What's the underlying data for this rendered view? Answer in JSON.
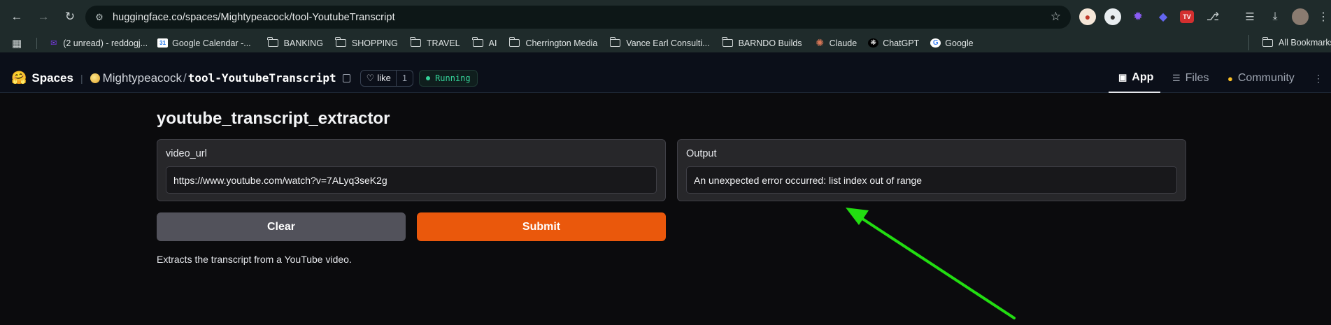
{
  "browser": {
    "url": "huggingface.co/spaces/Mightypeacock/tool-YoutubeTranscript",
    "bookmarks": [
      {
        "label": "(2 unread) - reddogj...",
        "icon": "yahoo-mail-icon",
        "type": "site"
      },
      {
        "label": "Google Calendar -...",
        "icon": "calendar-icon",
        "type": "site"
      },
      {
        "label": "BANKING",
        "icon": "folder-icon",
        "type": "folder"
      },
      {
        "label": "SHOPPING",
        "icon": "folder-icon",
        "type": "folder"
      },
      {
        "label": "TRAVEL",
        "icon": "folder-icon",
        "type": "folder"
      },
      {
        "label": "AI",
        "icon": "folder-icon",
        "type": "folder"
      },
      {
        "label": "Cherrington Media",
        "icon": "folder-icon",
        "type": "folder"
      },
      {
        "label": "Vance Earl Consulti...",
        "icon": "folder-icon",
        "type": "folder"
      },
      {
        "label": "BARNDO Builds",
        "icon": "folder-icon",
        "type": "folder"
      },
      {
        "label": "Claude",
        "icon": "claude-icon",
        "type": "site"
      },
      {
        "label": "ChatGPT",
        "icon": "chatgpt-icon",
        "type": "site"
      },
      {
        "label": "Google",
        "icon": "google-icon",
        "type": "site"
      }
    ],
    "all_bookmarks": "All Bookmarks"
  },
  "hf": {
    "spaces_label": "Spaces",
    "owner": "Mightypeacock",
    "slash": "/",
    "repo": "tool-YoutubeTranscript",
    "like_label": "like",
    "like_count": "1",
    "status": "Running",
    "tabs": [
      {
        "label": "App",
        "icon": "app-icon",
        "active": true
      },
      {
        "label": "Files",
        "icon": "files-icon",
        "active": false
      },
      {
        "label": "Community",
        "icon": "community-icon",
        "active": false
      }
    ]
  },
  "app": {
    "title": "youtube_transcript_extractor",
    "input_label": "video_url",
    "input_value": "https://www.youtube.com/watch?v=7ALyq3seK2g",
    "output_label": "Output",
    "output_value": "An unexpected error occurred: list index out of range",
    "clear_label": "Clear",
    "submit_label": "Submit",
    "description": "Extracts the transcript from a YouTube video."
  },
  "annotation": {
    "arrow_color": "#22dd11"
  }
}
